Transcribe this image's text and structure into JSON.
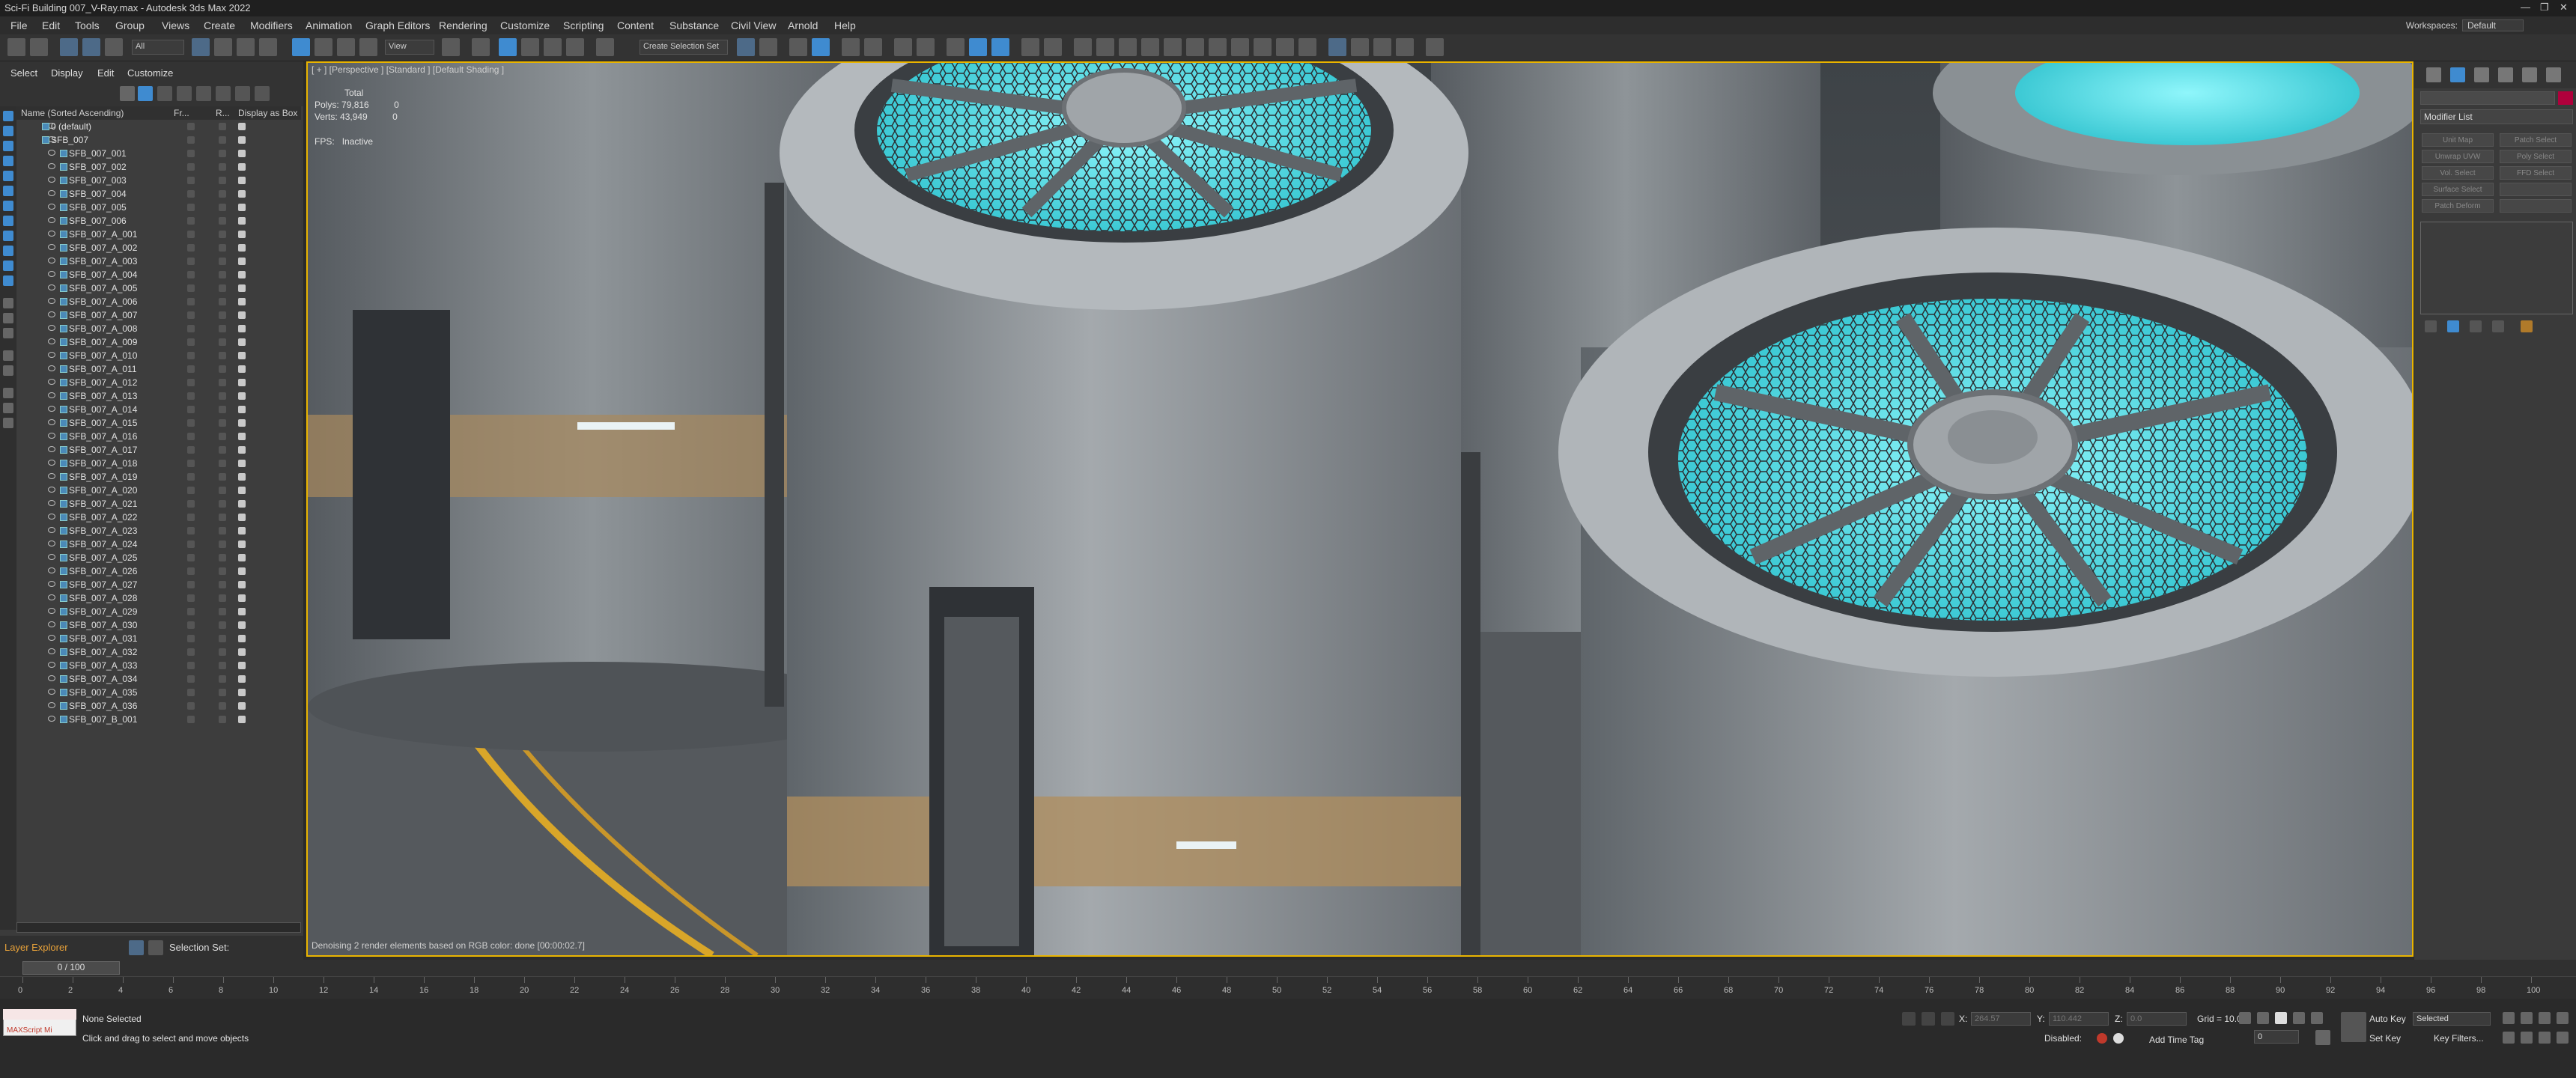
{
  "window": {
    "title": "Sci-Fi Building 007_V-Ray.max - Autodesk 3ds Max 2022"
  },
  "menu": [
    "File",
    "Edit",
    "Tools",
    "Group",
    "Views",
    "Create",
    "Modifiers",
    "Animation",
    "Graph Editors",
    "Rendering",
    "Customize",
    "Scripting",
    "Content",
    "Substance",
    "Civil View",
    "Arnold",
    "Help"
  ],
  "workspace": {
    "label": "Workspaces:",
    "value": "Default"
  },
  "toolbar": {
    "filter": "All",
    "view": "View",
    "selection_set": "Create Selection Set"
  },
  "explorer": {
    "menu": [
      "Select",
      "Display",
      "Edit",
      "Customize"
    ],
    "columns": {
      "name": "Name (Sorted Ascending)",
      "fr": "Fr...",
      "r": "R...",
      "box": "Display as Box"
    },
    "rows": [
      "0 (default)",
      "SFB_007",
      "SFB_007_001",
      "SFB_007_002",
      "SFB_007_003",
      "SFB_007_004",
      "SFB_007_005",
      "SFB_007_006",
      "SFB_007_A_001",
      "SFB_007_A_002",
      "SFB_007_A_003",
      "SFB_007_A_004",
      "SFB_007_A_005",
      "SFB_007_A_006",
      "SFB_007_A_007",
      "SFB_007_A_008",
      "SFB_007_A_009",
      "SFB_007_A_010",
      "SFB_007_A_011",
      "SFB_007_A_012",
      "SFB_007_A_013",
      "SFB_007_A_014",
      "SFB_007_A_015",
      "SFB_007_A_016",
      "SFB_007_A_017",
      "SFB_007_A_018",
      "SFB_007_A_019",
      "SFB_007_A_020",
      "SFB_007_A_021",
      "SFB_007_A_022",
      "SFB_007_A_023",
      "SFB_007_A_024",
      "SFB_007_A_025",
      "SFB_007_A_026",
      "SFB_007_A_027",
      "SFB_007_A_028",
      "SFB_007_A_029",
      "SFB_007_A_030",
      "SFB_007_A_031",
      "SFB_007_A_032",
      "SFB_007_A_033",
      "SFB_007_A_034",
      "SFB_007_A_035",
      "SFB_007_A_036",
      "SFB_007_B_001"
    ],
    "layer_explorer": "Layer Explorer",
    "selection_set": "Selection Set:"
  },
  "viewport": {
    "label": "[ + ] [Perspective ] [Standard ] [Default Shading ]",
    "stats_total": "Total",
    "polys_label": "Polys:",
    "polys_value": "79,816",
    "polys_sel": "0",
    "verts_label": "Verts:",
    "verts_value": "43,949",
    "verts_sel": "0",
    "fps_label": "FPS:",
    "fps_value": "Inactive",
    "denoise": "Denoising 2 render elements based on RGB color: done [00:00:02.7]"
  },
  "command_panel": {
    "modifier_list": "Modifier List",
    "buttons": [
      "Unit Map",
      "Patch Select",
      "Unwrap UVW",
      "Poly Select",
      "Vol. Select",
      "FFD Select",
      "Surface Select",
      "",
      "Patch Deform",
      ""
    ]
  },
  "timeline": {
    "frame": "0 / 100",
    "ticks": [
      0,
      2,
      4,
      6,
      8,
      10,
      12,
      14,
      16,
      18,
      20,
      22,
      24,
      26,
      28,
      30,
      32,
      34,
      36,
      38,
      40,
      42,
      44,
      46,
      48,
      50,
      52,
      54,
      56,
      58,
      60,
      62,
      64,
      66,
      68,
      70,
      72,
      74,
      76,
      78,
      80,
      82,
      84,
      86,
      88,
      90,
      92,
      94,
      96,
      98,
      100
    ]
  },
  "status": {
    "maxscript": "MAXScript Mi",
    "selection": "None Selected",
    "prompt": "Click and drag to select and move objects",
    "x_label": "X:",
    "x_value": "264.57",
    "y_label": "Y:",
    "y_value": "110.442",
    "z_label": "Z:",
    "z_value": "0.0",
    "grid": "Grid = 10.0",
    "disabled": "Disabled:",
    "add_time_tag": "Add Time Tag",
    "auto_key": "Auto Key",
    "set_key": "Set Key",
    "selected": "Selected",
    "key_filters": "Key Filters...",
    "frame_field": "0"
  },
  "colors": {
    "accent": "#e9b400",
    "cyan_glow": "#5fe3ec",
    "metal": "#9aa0a5"
  }
}
